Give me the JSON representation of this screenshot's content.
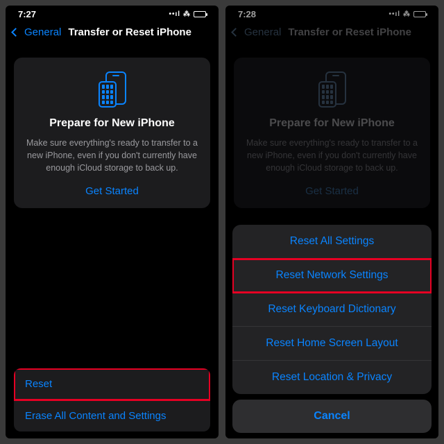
{
  "left": {
    "statusbar": {
      "time": "7:27"
    },
    "nav": {
      "back": "General",
      "title": "Transfer or Reset iPhone"
    },
    "card": {
      "title": "Prepare for New iPhone",
      "body": "Make sure everything's ready to transfer to a new iPhone, even if you don't currently have enough iCloud storage to back up.",
      "cta": "Get Started"
    },
    "rows": {
      "reset": "Reset",
      "erase": "Erase All Content and Settings"
    }
  },
  "right": {
    "statusbar": {
      "time": "7:28"
    },
    "nav": {
      "back": "General",
      "title": "Transfer or Reset iPhone"
    },
    "card": {
      "title": "Prepare for New iPhone",
      "body": "Make sure everything's ready to transfer to a new iPhone, even if you don't currently have enough iCloud storage to back up.",
      "cta": "Get Started"
    },
    "sheet": {
      "options": {
        "all": "Reset All Settings",
        "network": "Reset Network Settings",
        "keyboard": "Reset Keyboard Dictionary",
        "home": "Reset Home Screen Layout",
        "location": "Reset Location & Privacy"
      },
      "cancel": "Cancel"
    }
  }
}
